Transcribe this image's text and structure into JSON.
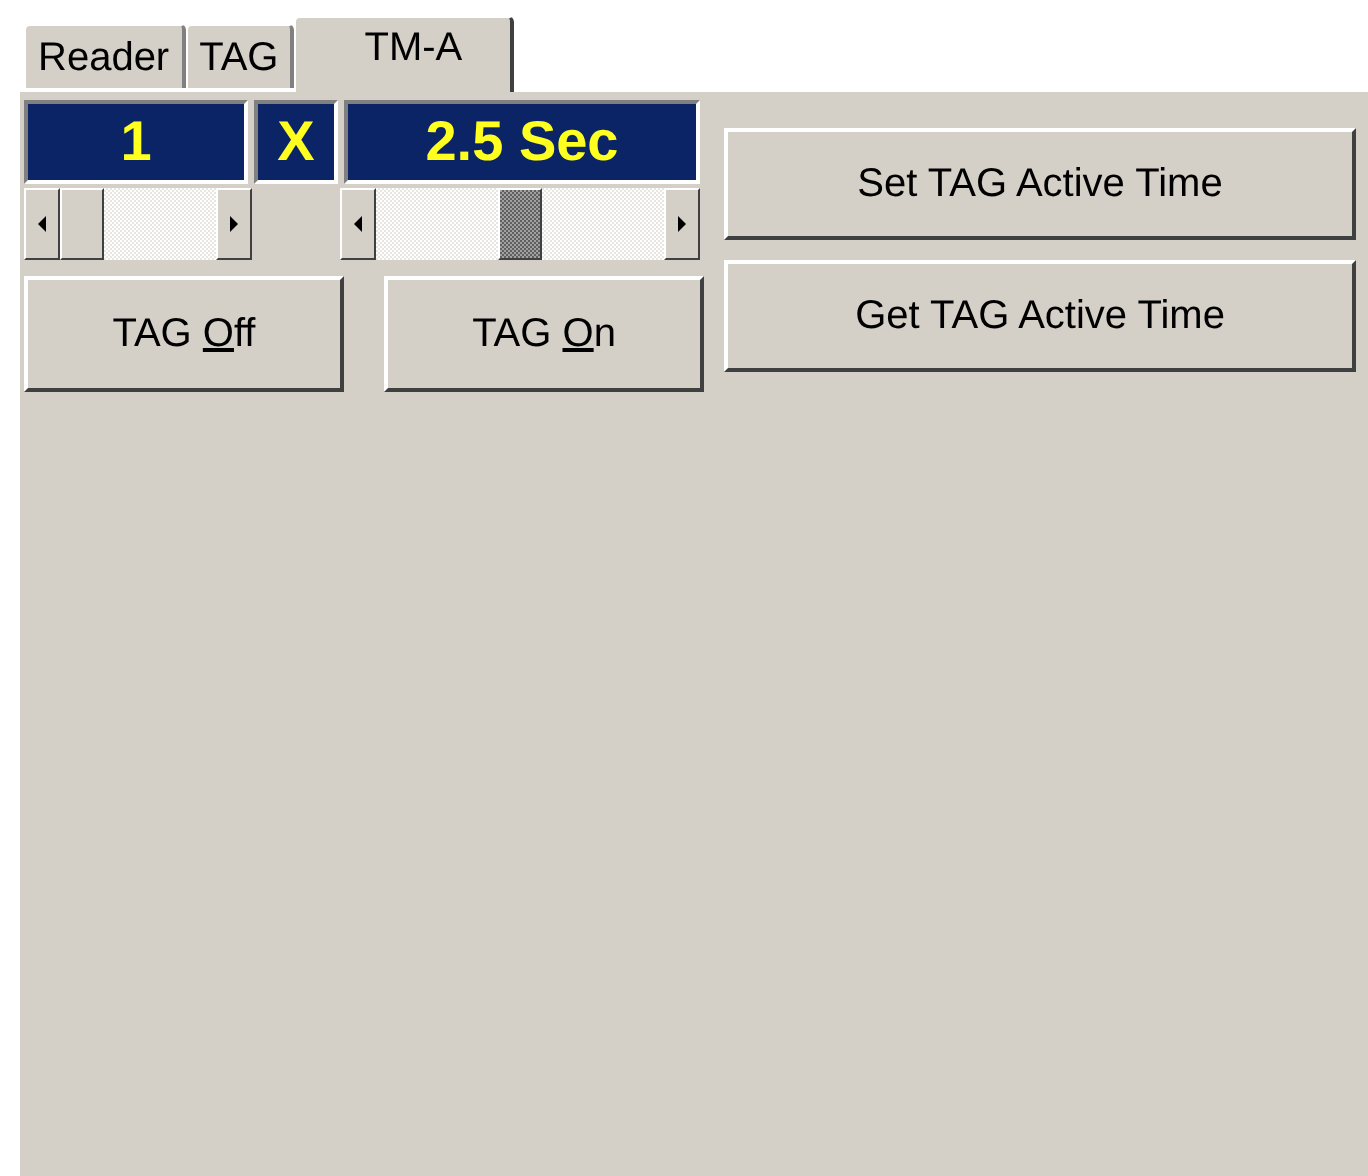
{
  "tabs": [
    {
      "label": "Reader",
      "selected": false
    },
    {
      "label": "TAG",
      "selected": false
    },
    {
      "label": "TM-A",
      "selected": true
    }
  ],
  "displays": [
    "1",
    "X",
    "2.5 Sec"
  ],
  "tag_buttons": [
    {
      "before": "TAG ",
      "mnemonic": "O",
      "after": "ff"
    },
    {
      "before": "TAG ",
      "mnemonic": "O",
      "after": "n"
    }
  ],
  "time_buttons": [
    {
      "label": "Set TAG Active Time"
    },
    {
      "label": "Get TAG Active Time"
    }
  ]
}
